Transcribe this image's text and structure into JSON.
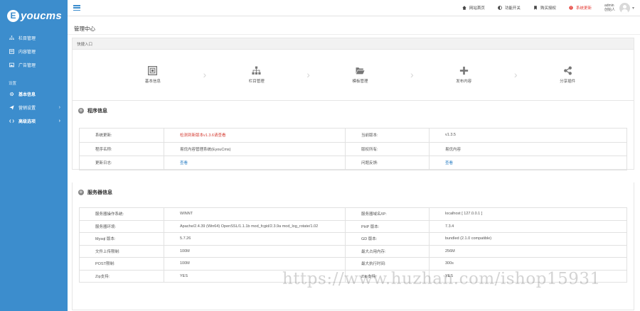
{
  "brand": {
    "mark": "E",
    "name": "youcms"
  },
  "sidebar": {
    "items": [
      {
        "label": "栏目管理",
        "icon": "sitemap-icon"
      },
      {
        "label": "内容管理",
        "icon": "list-icon"
      },
      {
        "label": "广告管理",
        "icon": "image-icon"
      }
    ],
    "group_label": "设置",
    "settings_items": [
      {
        "label": "基本信息",
        "icon": "gear-icon"
      },
      {
        "label": "营销设置",
        "icon": "send-icon"
      },
      {
        "label": "高级选项",
        "icon": "code-icon"
      }
    ]
  },
  "topbar": {
    "links": [
      {
        "label": "网站首页",
        "icon": "home-icon"
      },
      {
        "label": "功能开关",
        "icon": "toggle-icon"
      },
      {
        "label": "购买授权",
        "icon": "bookmark-icon"
      },
      {
        "label": "系统更新",
        "icon": "alert-icon"
      }
    ],
    "user": {
      "name": "admin",
      "role": "创始人"
    }
  },
  "page": {
    "title": "管理中心"
  },
  "quick": {
    "title": "快捷入口",
    "items": [
      {
        "label": "基本信息",
        "icon": "form-icon"
      },
      {
        "label": "栏目管理",
        "icon": "sitemap-icon"
      },
      {
        "label": "模板管理",
        "icon": "folder-open-icon"
      },
      {
        "label": "发布内容",
        "icon": "plus-icon"
      },
      {
        "label": "分享插件",
        "icon": "share-icon"
      }
    ]
  },
  "program_info": {
    "title": "程序信息",
    "rows": [
      [
        "系统更新:",
        "检测到新版本v1.3.6请查看",
        "当前版本:",
        "v1.3.5"
      ],
      [
        "程序名称:",
        "易优内容管理系统(EyouCms)",
        "版权所有:",
        "易优内容"
      ],
      [
        "更新日志:",
        "查看",
        "问题反馈:",
        "查看"
      ]
    ]
  },
  "server_info": {
    "title": "服务器信息",
    "rows": [
      [
        "服务器操作系统:",
        "WINNT",
        "服务器域名/IP:",
        "localhost [ 127.0.0.1 ]"
      ],
      [
        "服务器环境:",
        "Apache/2.4.39 (Win64) OpenSSL/1.1.1b mod_fcgid/2.3.9a mod_log_rotate/1.02",
        "PHP 版本:",
        "7.3.4"
      ],
      [
        "Mysql 版本:",
        "5.7.26",
        "GD 版本:",
        "bundled (2.1.0 compatible)"
      ],
      [
        "文件上传限制:",
        "100M",
        "最大占用内存:",
        "256M"
      ],
      [
        "POST限制:",
        "100M",
        "最大执行时间:",
        "300s"
      ],
      [
        "Zip支持:",
        "YES",
        "Zlib支持:",
        "YES"
      ]
    ]
  },
  "watermark": "https://www.huzhan.com/ishop15931",
  "colors": {
    "sidebar": "#3c8dcd",
    "accent": "#3c8dcd",
    "alert": "#e5423b",
    "link": "#2c7fc5"
  }
}
